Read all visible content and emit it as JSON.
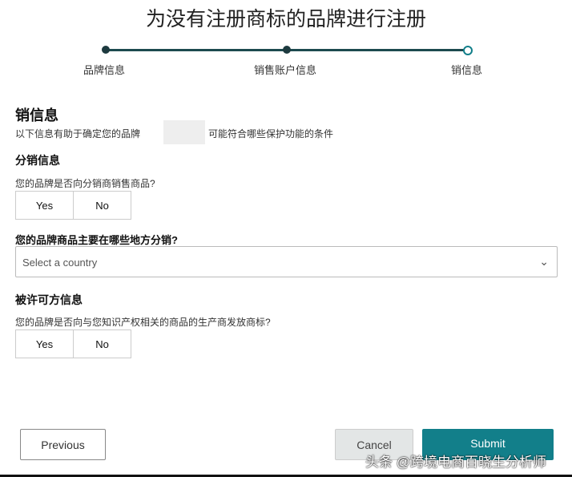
{
  "title": "为没有注册商标的品牌进行注册",
  "steps": [
    "品牌信息",
    "销售账户信息",
    "销信息"
  ],
  "section_title": "销信息",
  "description_pre": "以下信息有助于确定您的品牌",
  "description_post": "可能符合哪些保护功能的条件",
  "distribution": {
    "heading": "分销信息",
    "question": "您的品牌是否向分销商销售商品?",
    "yes": "Yes",
    "no": "No"
  },
  "country": {
    "label": "您的品牌商品主要在哪些地方分销?",
    "placeholder": "Select a country"
  },
  "licensee": {
    "heading": "被许可方信息",
    "question": "您的品牌是否向与您知识产权相关的商品的生产商发放商标?",
    "yes": "Yes",
    "no": "No"
  },
  "buttons": {
    "previous": "Previous",
    "cancel": "Cancel",
    "submit": "Submit"
  },
  "watermark": "头条 @跨境电商百晓生分析师",
  "colors": {
    "accent": "#127f8a"
  }
}
